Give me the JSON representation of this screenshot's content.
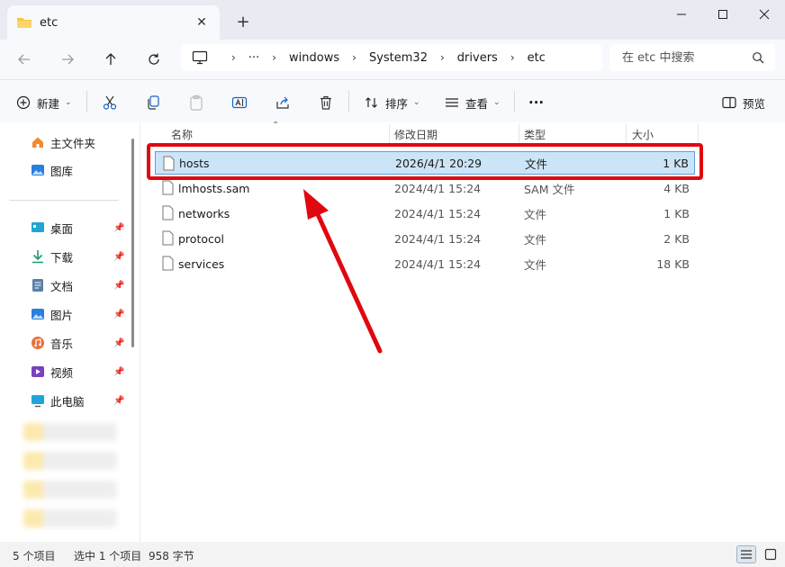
{
  "window": {
    "tab_title": "etc",
    "new_tab": "+",
    "close_tab": "✕"
  },
  "address": {
    "crumbs": [
      "windows",
      "System32",
      "drivers",
      "etc"
    ],
    "more": "···",
    "search_placeholder": "在 etc 中搜索"
  },
  "toolbar": {
    "new_label": "新建",
    "sort_label": "排序",
    "view_label": "查看",
    "more_label": "···",
    "preview_label": "预览"
  },
  "sidebar": {
    "top": [
      {
        "label": "主文件夹",
        "icon": "home-icon"
      },
      {
        "label": "图库",
        "icon": "gallery-icon"
      }
    ],
    "pinned": [
      {
        "label": "桌面",
        "icon": "desktop-icon"
      },
      {
        "label": "下载",
        "icon": "download-icon"
      },
      {
        "label": "文档",
        "icon": "document-icon"
      },
      {
        "label": "图片",
        "icon": "pictures-icon"
      },
      {
        "label": "音乐",
        "icon": "music-icon"
      },
      {
        "label": "视频",
        "icon": "video-icon"
      },
      {
        "label": "此电脑",
        "icon": "this-pc-icon"
      }
    ]
  },
  "columns": {
    "name": "名称",
    "date": "修改日期",
    "type": "类型",
    "size": "大小"
  },
  "files": [
    {
      "name": "hosts",
      "date": "2026/4/1 20:29",
      "type": "文件",
      "size": "1 KB",
      "selected": true
    },
    {
      "name": "lmhosts.sam",
      "date": "2024/4/1 15:24",
      "type": "SAM 文件",
      "size": "4 KB"
    },
    {
      "name": "networks",
      "date": "2024/4/1 15:24",
      "type": "文件",
      "size": "1 KB"
    },
    {
      "name": "protocol",
      "date": "2024/4/1 15:24",
      "type": "文件",
      "size": "2 KB"
    },
    {
      "name": "services",
      "date": "2024/4/1 15:24",
      "type": "文件",
      "size": "18 KB"
    }
  ],
  "status": {
    "count": "5 个项目",
    "selection": "选中 1 个项目",
    "bytes": "958 字节"
  },
  "colors": {
    "highlight": "#e1070f",
    "selection": "#cce4f7",
    "folder": "#f6c445"
  }
}
